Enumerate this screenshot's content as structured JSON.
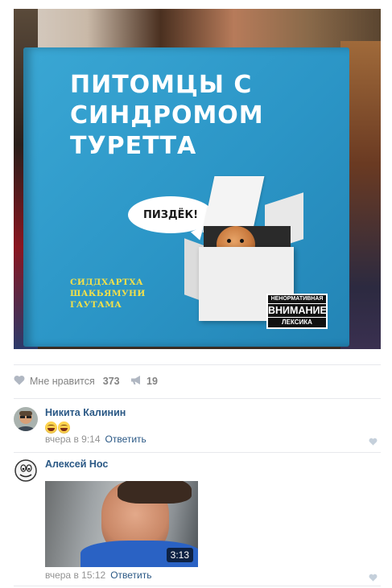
{
  "post": {
    "photo": {
      "book_title": "ПИТОМЦЫ С СИНДРОМОМ ТУРЕТТА",
      "book_author": "СИДДХАРТХА ШАКЬЯМУНИ ГАУТАМА",
      "speech_bubble": "ПИЗДЁК!",
      "warning_line1": "НЕНОРМАТИВНАЯ",
      "warning_line2": "ВНИМАНИЕ",
      "warning_line3": "ЛЕКСИКА"
    },
    "actions": {
      "like_label": "Мне нравится",
      "like_count": "373",
      "share_count": "19",
      "like_icon": "heart-icon",
      "share_icon": "megaphone-icon"
    }
  },
  "comments": [
    {
      "author": "Никита Калинин",
      "emoji": [
        "joy-emoji",
        "joy-emoji"
      ],
      "time": "вчера в 9:14",
      "reply_label": "Ответить"
    },
    {
      "author": "Алексей Нос",
      "attachment": {
        "type": "video",
        "duration": "3:13"
      },
      "time": "вчера в 15:12",
      "reply_label": "Ответить"
    }
  ],
  "colors": {
    "link": "#2a5885",
    "muted": "#828282",
    "divider": "#e7e8ec",
    "book_blue": "#2b95c6"
  }
}
